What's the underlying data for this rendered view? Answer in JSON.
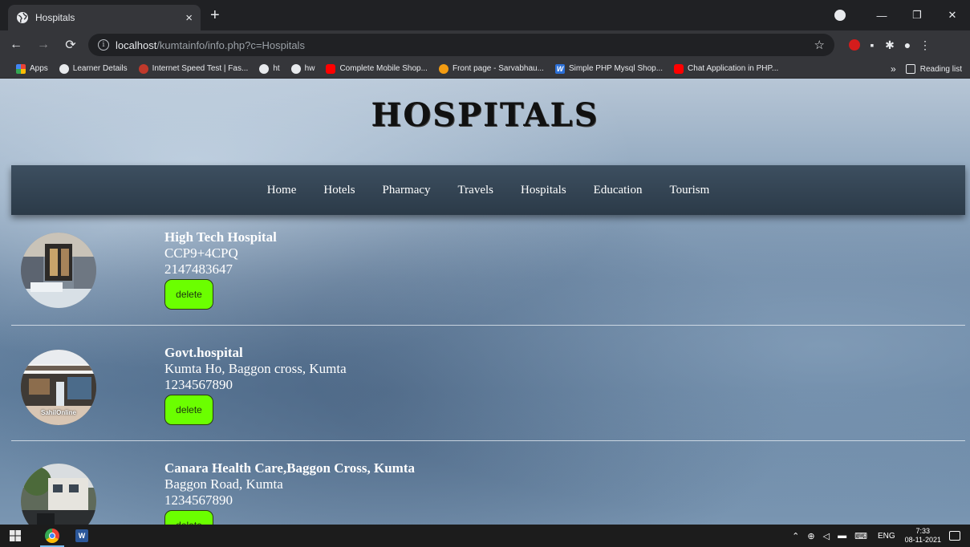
{
  "browser": {
    "tab_title": "Hospitals",
    "tab_close": "×",
    "new_tab": "+",
    "url_host": "localhost",
    "url_path": "/kumtainfo/info.php?c=Hospitals",
    "bookmarks": [
      {
        "label": "Apps",
        "icon": "apps-icon"
      },
      {
        "label": "Learner Details",
        "icon": "globe-icon"
      },
      {
        "label": "Internet Speed Test | Fas...",
        "icon": "speedometer-icon"
      },
      {
        "label": "ht",
        "icon": "globe-icon"
      },
      {
        "label": "hw",
        "icon": "globe-icon"
      },
      {
        "label": "Complete Mobile Shop...",
        "icon": "youtube-icon"
      },
      {
        "label": "Front page - Sarvabhau...",
        "icon": "site-icon"
      },
      {
        "label": "Simple PHP Mysql Shop...",
        "icon": "w-icon"
      },
      {
        "label": "Chat Application in PHP...",
        "icon": "youtube-icon"
      }
    ],
    "more_bookmarks": "»",
    "reading_list": "Reading list"
  },
  "page": {
    "title": "HOSPITALS",
    "nav": [
      "Home",
      "Hotels",
      "Pharmacy",
      "Travels",
      "Hospitals",
      "Education",
      "Tourism"
    ],
    "entries": [
      {
        "name": "High Tech Hospital",
        "address": "CCP9+4CPQ",
        "phone": "2147483647",
        "delete_label": "delete",
        "thumb_watermark": ""
      },
      {
        "name": "Govt.hospital",
        "address": "Kumta Ho, Baggon cross, Kumta",
        "phone": "1234567890",
        "delete_label": "delete",
        "thumb_watermark": "SahilOnline"
      },
      {
        "name": "Canara Health Care,Baggon Cross, Kumta",
        "address": "Baggon Road, Kumta",
        "phone": "1234567890",
        "delete_label": "delete",
        "thumb_watermark": ""
      }
    ]
  },
  "taskbar": {
    "lang": "ENG",
    "time": "7:33",
    "date": "08-11-2021",
    "word_label": "W"
  },
  "colors": {
    "delete_button": "#6bff00",
    "navbar": "#2b3a48",
    "chrome_dark": "#202124"
  }
}
